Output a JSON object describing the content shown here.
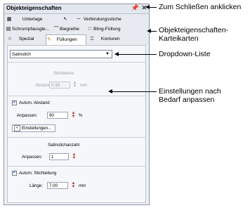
{
  "panel": {
    "title": "Objekteigenschaften",
    "pin_glyph": "ȣ",
    "close_glyph": "✕"
  },
  "tabs": [
    {
      "label": "Unterlage",
      "icon": "underlay-icon"
    },
    {
      "label": "",
      "icon": "cursor-icon"
    },
    {
      "label": "Verbindungsstiche",
      "icon": "connector-icon"
    },
    {
      "label": "Schrumpfausgle...",
      "icon": "shrink-icon"
    },
    {
      "label": "Biegreihe",
      "icon": "bend-icon"
    },
    {
      "label": "Bling-Füllung",
      "icon": "bling-icon"
    },
    {
      "label": "Spezial",
      "icon": "star-icon"
    },
    {
      "label": "Füllungen",
      "icon": "fill-icon"
    },
    {
      "label": "Konturen",
      "icon": "outline-icon"
    }
  ],
  "body": {
    "dropdown_value": "Satinstich",
    "stitch_values_heading": "Stichwerte",
    "spacing_label": "Abstand:",
    "spacing_value": "0.38",
    "spacing_unit": "mm",
    "auto_spacing_label": "Autom. Abstand",
    "adjust_label": "Anpassen:",
    "adjust_value": "90",
    "adjust_unit": "%",
    "settings_button": "Einstellungen...",
    "satin_count_heading": "Satinstichanzahl",
    "adjust2_label": "Anpassen:",
    "adjust2_value": "1",
    "auto_split_label": "Autom. Stichteilung",
    "length_label": "Länge:",
    "length_value": "7.00",
    "length_unit": "mm"
  },
  "callouts": {
    "close": "Zum Schließen anklicken",
    "tabs_line1": "Objekteigenschaften-",
    "tabs_line2": "Karteikarten",
    "dropdown": "Dropdown-Liste",
    "settings_line1": "Einstellungen nach",
    "settings_line2": "Bedarf anpassen"
  }
}
